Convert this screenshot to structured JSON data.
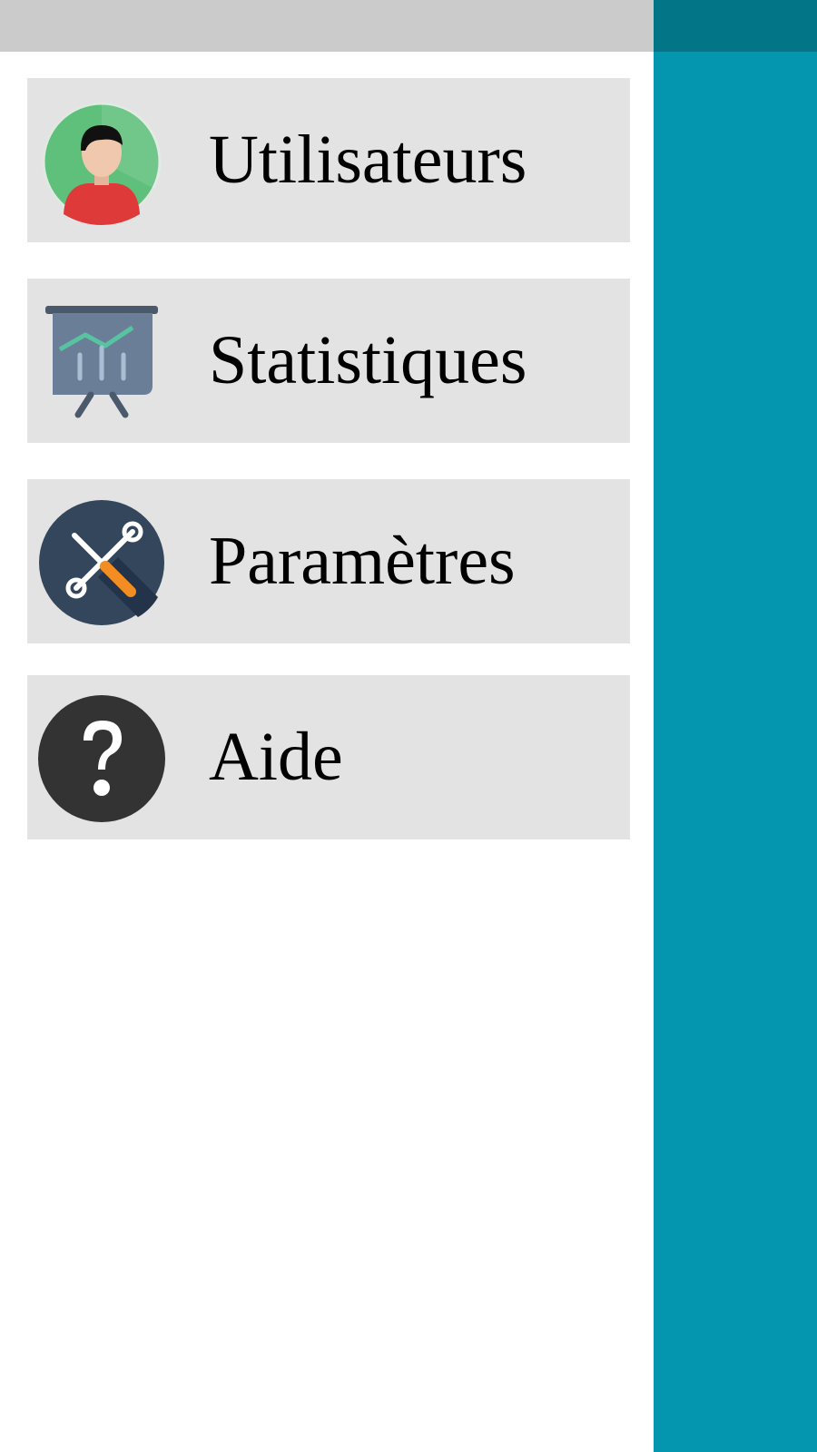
{
  "drawer": {
    "items": [
      {
        "label": "Utilisateurs",
        "icon": "user-avatar-icon"
      },
      {
        "label": "Statistiques",
        "icon": "presentation-chart-icon"
      },
      {
        "label": "Paramètres",
        "icon": "tools-settings-icon"
      },
      {
        "label": "Aide",
        "icon": "help-question-icon"
      }
    ]
  },
  "colors": {
    "drawer_header": "#cbcbcb",
    "item_background": "#e3e3e3",
    "main_background": "#0396ae",
    "main_toolbar": "#027686"
  }
}
